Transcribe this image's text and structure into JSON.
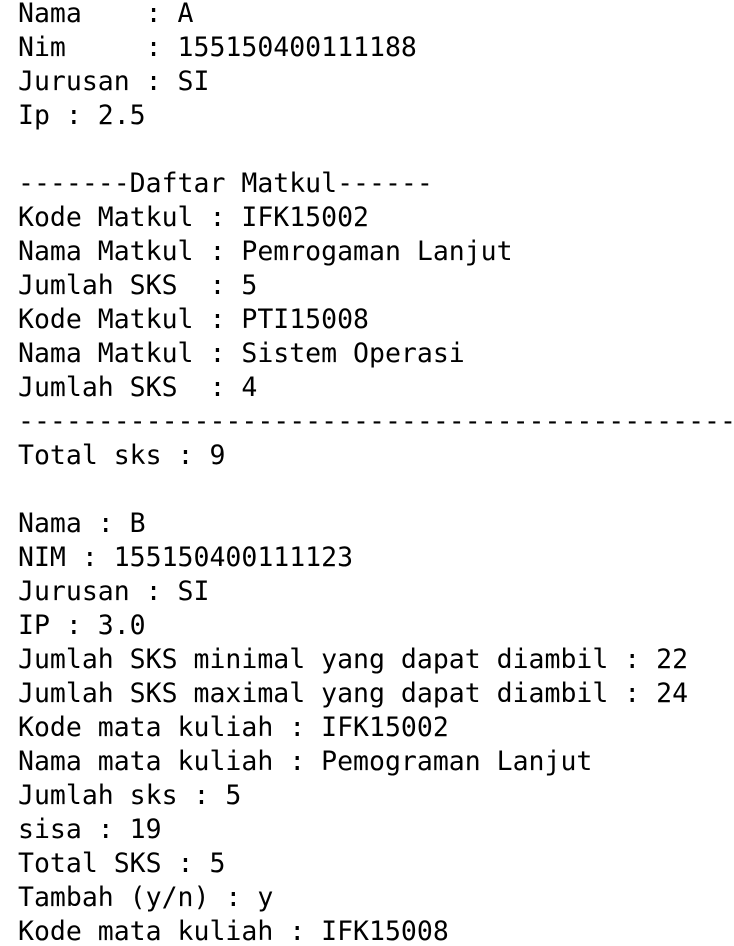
{
  "console": {
    "lines": [
      "Nama    : A",
      "Nim     : 155150400111188",
      "Jurusan : SI",
      "Ip : 2.5",
      "",
      "-------Daftar Matkul------",
      "Kode Matkul : IFK15002",
      "Nama Matkul : Pemrogaman Lanjut",
      "Jumlah SKS  : 5",
      "Kode Matkul : PTI15008",
      "Nama Matkul : Sistem Operasi",
      "Jumlah SKS  : 4",
      "---------------------------------------------",
      "Total sks : 9",
      "",
      "Nama : B",
      "NIM : 155150400111123",
      "Jurusan : SI",
      "IP : 3.0",
      "Jumlah SKS minimal yang dapat diambil : 22",
      "Jumlah SKS maximal yang dapat diambil : 24",
      "Kode mata kuliah : IFK15002",
      "Nama mata kuliah : Pemograman Lanjut",
      "Jumlah sks : 5",
      "sisa : 19",
      "Total SKS : 5",
      "Tambah (y/n) : y",
      "Kode mata kuliah : IFK15008"
    ]
  }
}
